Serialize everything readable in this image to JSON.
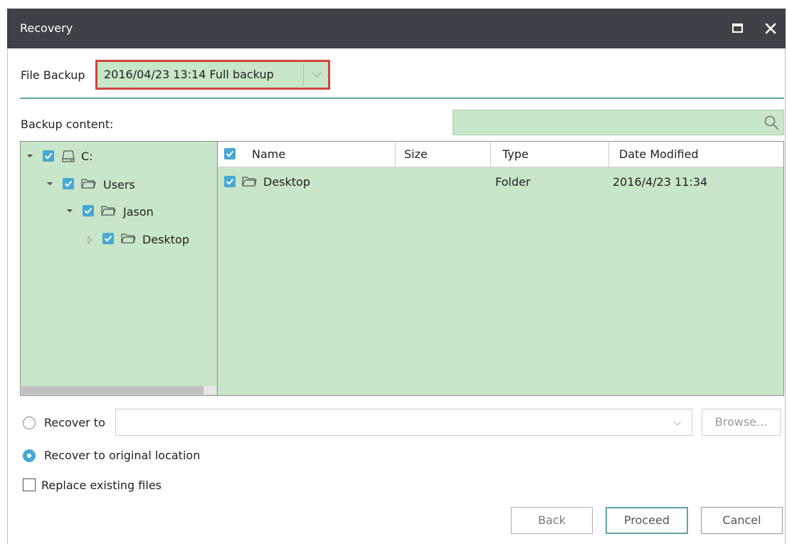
{
  "window": {
    "title": "Recovery",
    "maximize_icon": "maximize-icon",
    "close_icon": "close-icon"
  },
  "file_backup": {
    "label": "File Backup",
    "selected": "2016/04/23 13:14 Full backup",
    "arrow_icon": "chevron-down-icon"
  },
  "backup_content": {
    "label": "Backup content:",
    "search_placeholder": "",
    "search_icon": "search-icon"
  },
  "tree": {
    "nodes": [
      {
        "label": "C:",
        "icon": "drive-icon",
        "checked": true,
        "expanded": true,
        "level": 0
      },
      {
        "label": "Users",
        "icon": "folder-icon",
        "checked": true,
        "expanded": true,
        "level": 1
      },
      {
        "label": "Jason",
        "icon": "folder-icon",
        "checked": true,
        "expanded": true,
        "level": 2
      },
      {
        "label": "Desktop",
        "icon": "folder-icon",
        "checked": true,
        "expanded": false,
        "level": 3
      }
    ]
  },
  "file_list": {
    "columns": [
      "Name",
      "Size",
      "Type",
      "Date Modified"
    ],
    "rows": [
      {
        "name": "Desktop",
        "size": "",
        "type": "Folder",
        "date_modified": "2016/4/23 11:34",
        "checked": true,
        "icon": "folder-icon"
      }
    ]
  },
  "options": {
    "recover_to_label": "Recover to",
    "recover_to_path": "",
    "browse_label": "Browse...",
    "recover_original_label": "Recover to original location",
    "recover_original_selected": true,
    "replace_existing_label": "Replace existing files",
    "replace_existing_checked": false
  },
  "buttons": {
    "back": "Back",
    "proceed": "Proceed",
    "cancel": "Cancel"
  },
  "colors": {
    "titlebar": "#3e4248",
    "highlight_green": "#c8e6c9",
    "accent_teal": "#5fa6a1",
    "checkbox_blue": "#48a8d4",
    "focus_red": "#d0463f"
  }
}
